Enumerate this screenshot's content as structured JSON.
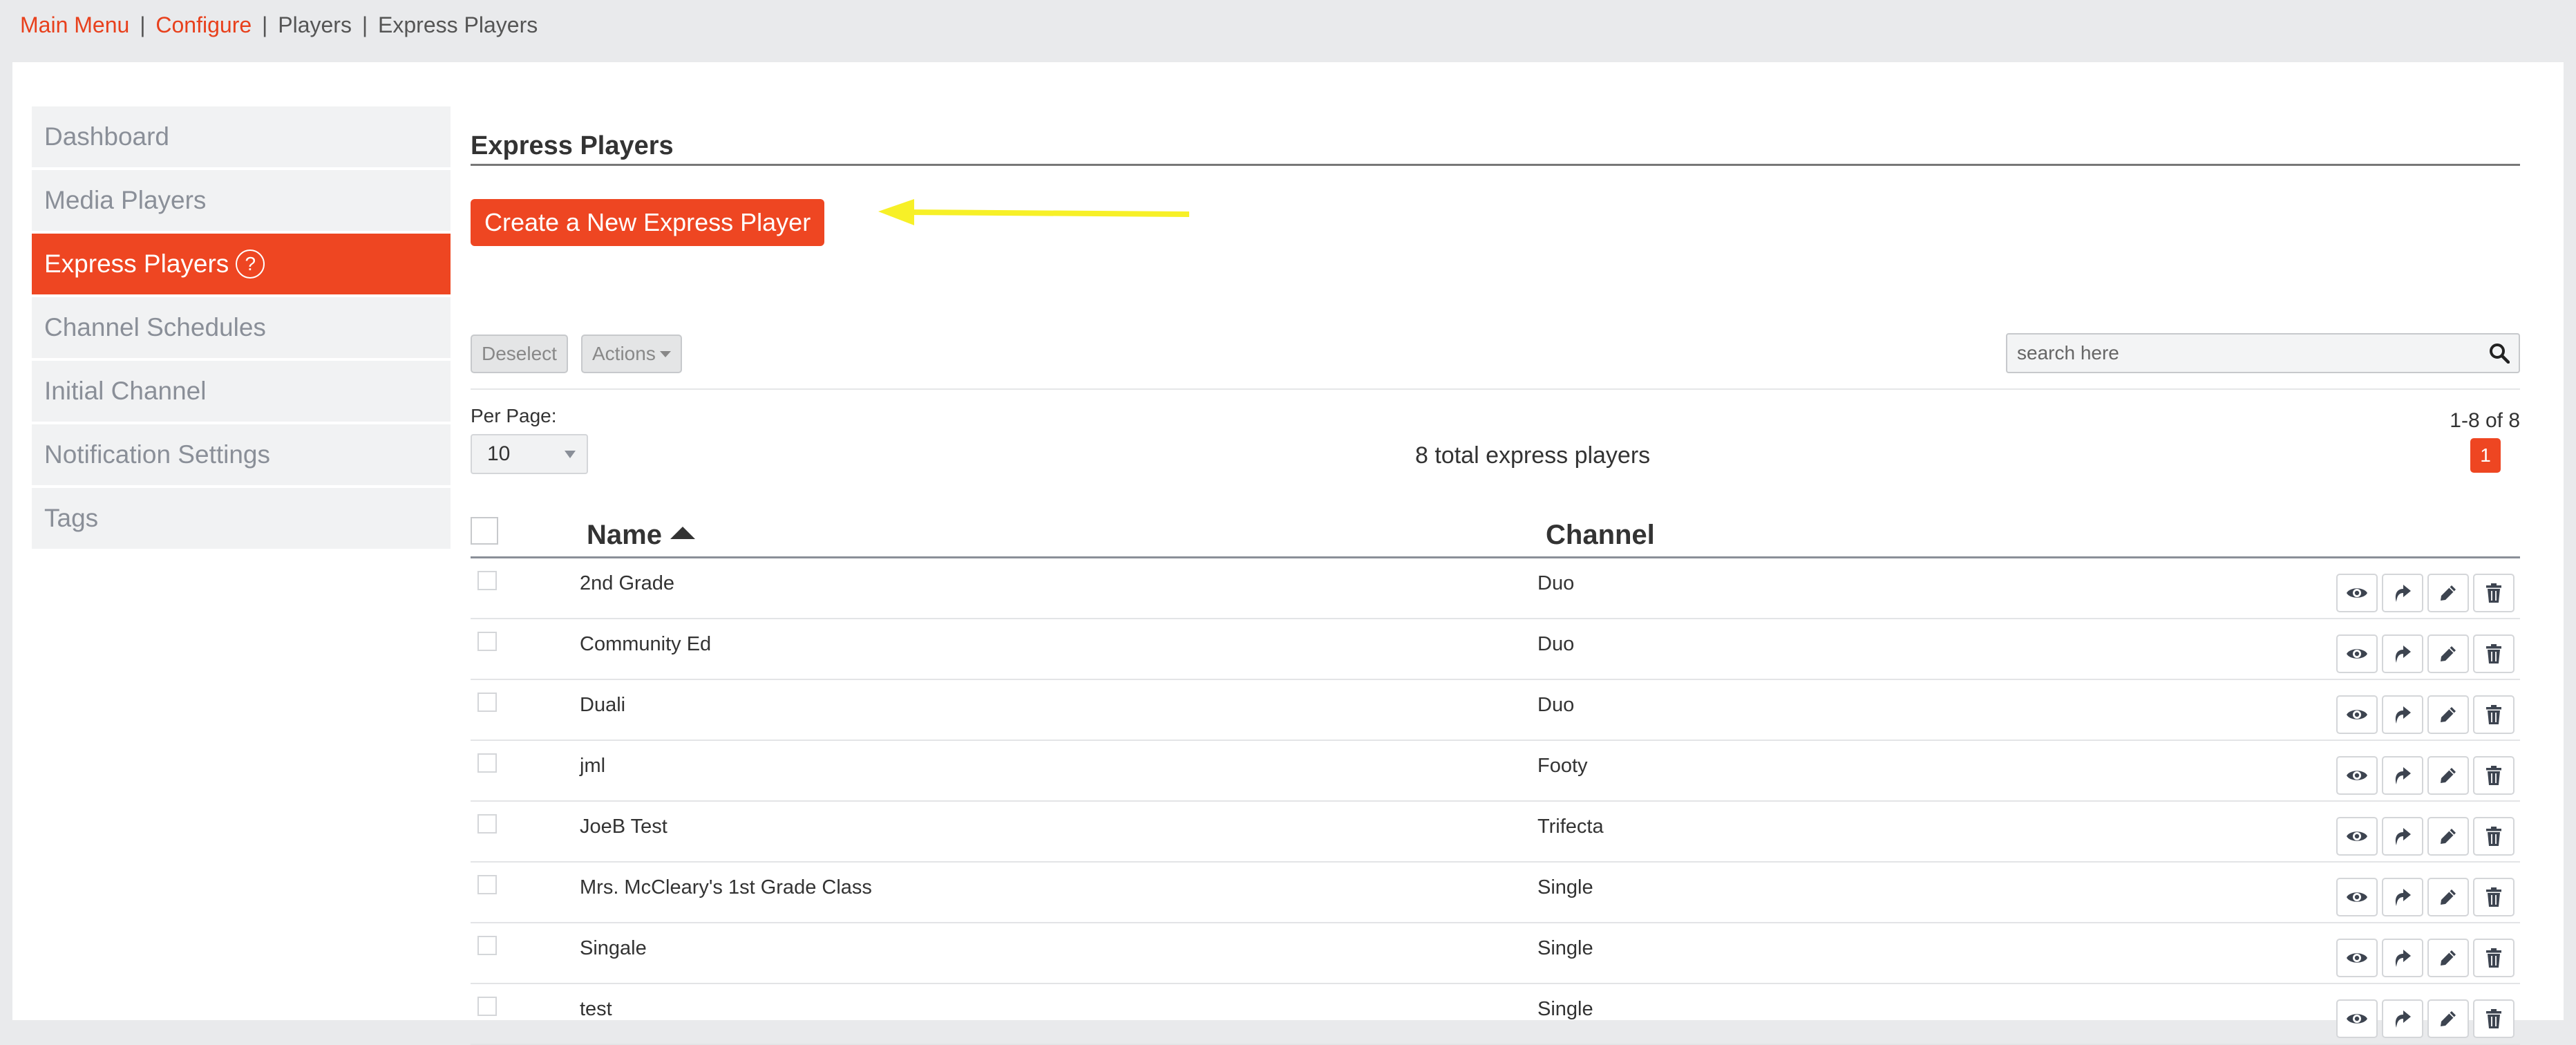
{
  "breadcrumb": {
    "main_menu": "Main Menu",
    "configure": "Configure",
    "players": "Players",
    "express_players": "Express Players",
    "separator": "|"
  },
  "sidebar": {
    "items": [
      {
        "label": "Dashboard"
      },
      {
        "label": "Media Players"
      },
      {
        "label": "Express Players",
        "help": "?"
      },
      {
        "label": "Channel Schedules"
      },
      {
        "label": "Initial Channel"
      },
      {
        "label": "Notification Settings"
      },
      {
        "label": "Tags"
      }
    ]
  },
  "main": {
    "title": "Express Players",
    "create_button": "Create a New Express Player",
    "deselect_button": "Deselect",
    "actions_button": "Actions",
    "search_placeholder": "search here",
    "per_page_label": "Per Page:",
    "per_page_value": "10",
    "total_text": "8 total express players",
    "range_text": "1-8 of 8",
    "current_page": "1"
  },
  "table": {
    "columns": [
      "Name",
      "Channel"
    ],
    "rows": [
      {
        "name": "2nd Grade",
        "channel": "Duo"
      },
      {
        "name": "Community Ed",
        "channel": "Duo"
      },
      {
        "name": "Duali",
        "channel": "Duo"
      },
      {
        "name": "jml",
        "channel": "Footy"
      },
      {
        "name": "JoeB Test",
        "channel": "Trifecta"
      },
      {
        "name": "Mrs. McCleary's 1st Grade Class",
        "channel": "Single"
      },
      {
        "name": "Singale",
        "channel": "Single"
      },
      {
        "name": "test",
        "channel": "Single"
      }
    ]
  },
  "colors": {
    "accent": "#ee4622",
    "link": "#e8401c",
    "annotation_arrow": "#f7f027"
  },
  "icons": {
    "row_actions": [
      "eye-icon",
      "share-icon",
      "pencil-icon",
      "trash-icon"
    ],
    "search": "search-icon",
    "sort": "sort-ascending-icon"
  }
}
